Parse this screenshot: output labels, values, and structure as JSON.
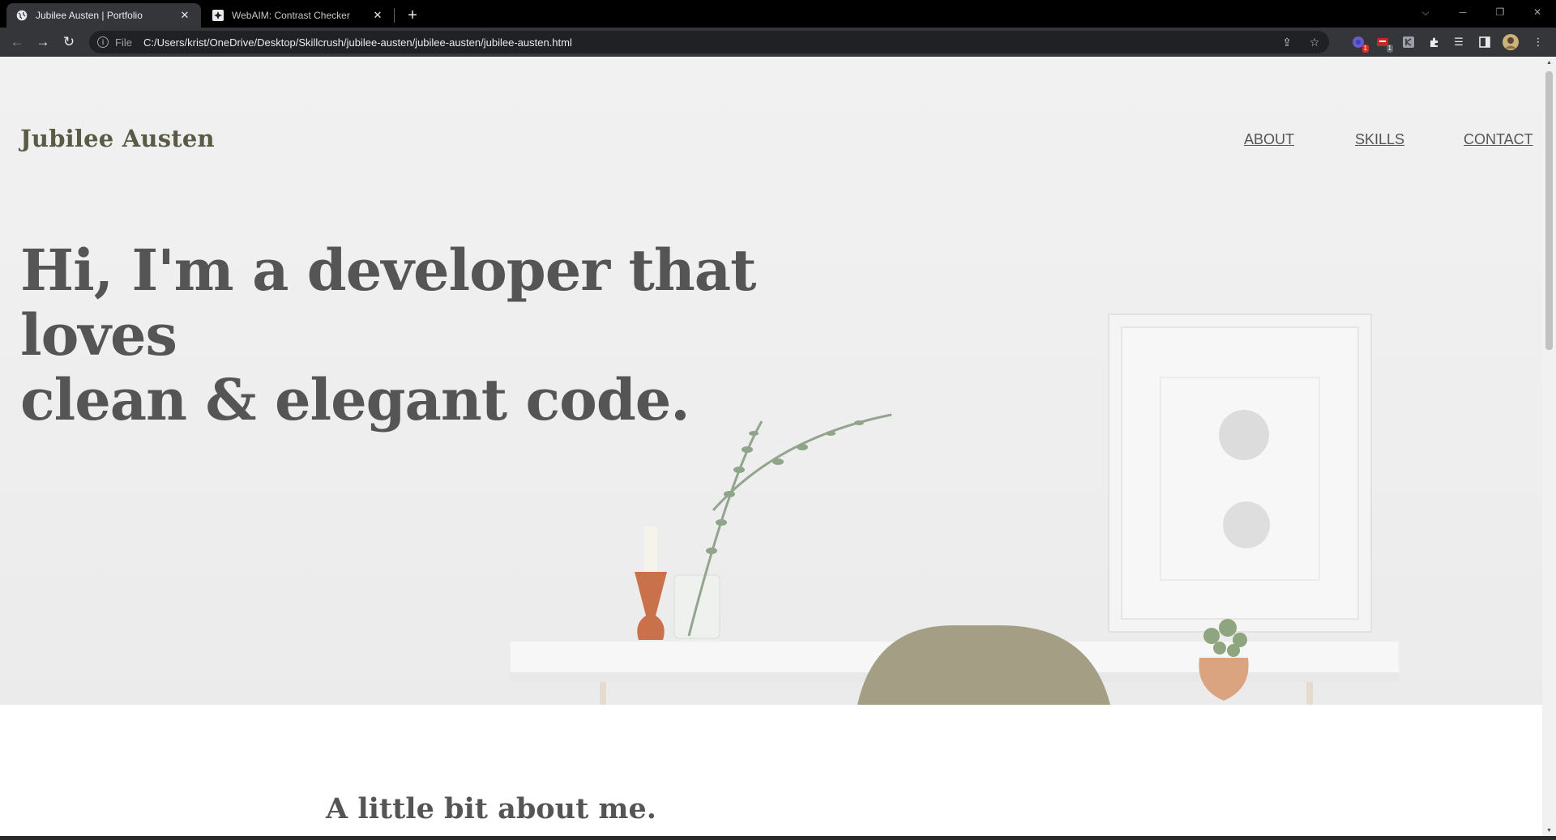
{
  "browser": {
    "tabs": [
      {
        "title": "Jubilee Austen | Portfolio",
        "active": true,
        "favicon": "globe-icon"
      },
      {
        "title": "WebAIM: Contrast Checker",
        "active": false,
        "favicon": "webaim-icon"
      }
    ],
    "address": {
      "scheme_label": "File",
      "url": "C:/Users/krist/OneDrive/Desktop/Skillcrush/jubilee-austen/jubilee-austen/jubilee-austen.html"
    },
    "extensions": [
      {
        "name": "extension-purple-icon",
        "badge": "1"
      },
      {
        "name": "extension-red-icon",
        "badge": "1"
      },
      {
        "name": "extension-grey-icon",
        "badge": ""
      }
    ]
  },
  "page": {
    "brand": "Jubilee Austen",
    "nav": {
      "about": "ABOUT",
      "skills": "SKILLS",
      "contact": "CONTACT"
    },
    "headline": {
      "line1": "Hi, I'm a developer that loves",
      "line2": "clean & elegant code."
    },
    "about_title": "A little bit about me."
  },
  "colors": {
    "brand_text": "#5a5a45",
    "heading_text": "#555555",
    "chrome_dark": "#35363a",
    "tabstrip": "#000000"
  }
}
